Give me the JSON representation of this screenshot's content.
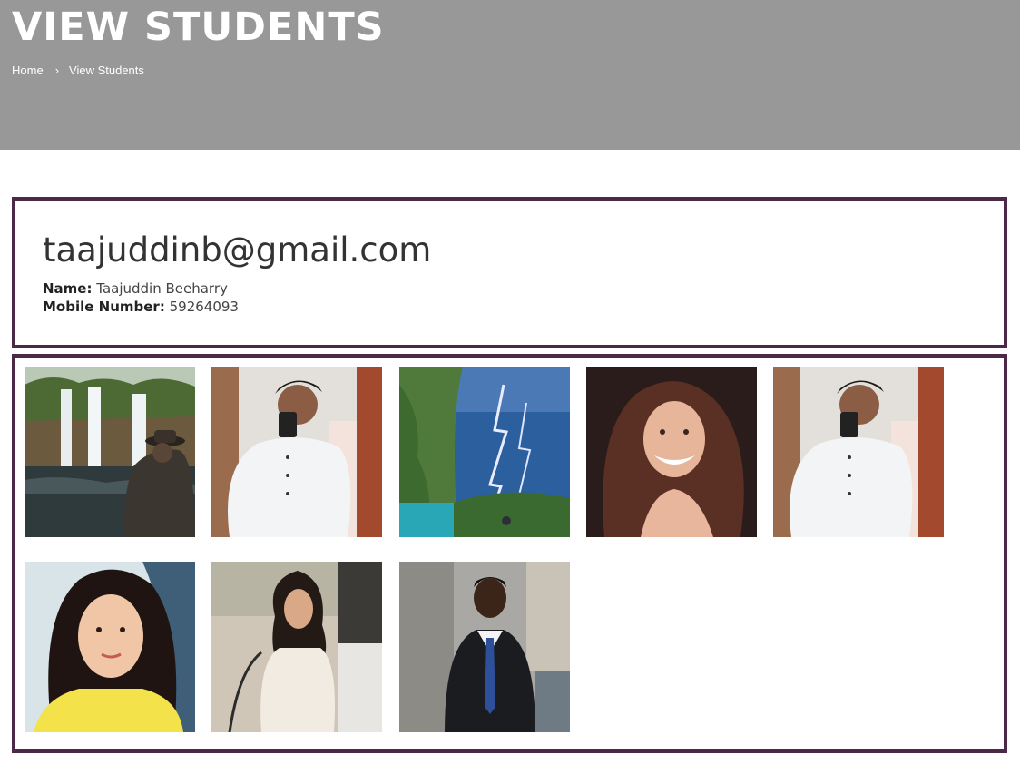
{
  "header": {
    "title": "VIEW STUDENTS",
    "breadcrumb": {
      "home": "Home",
      "separator": "›",
      "current": "View Students"
    }
  },
  "student": {
    "email": "taajuddinb@gmail.com",
    "name_label": "Name:",
    "name": "Taajuddin Beeharry",
    "mobile_label": "Mobile Number:",
    "mobile": "59264093"
  },
  "colors": {
    "hero_bg": "#989898",
    "card_border": "#4a2a47"
  },
  "gallery": {
    "photos": [
      {
        "subject": "waterfall-with-person-in-hat"
      },
      {
        "subject": "man-mirror-selfie-white-shirt"
      },
      {
        "subject": "lightning-storm-landscape"
      },
      {
        "subject": "smiling-woman-curly-hair"
      },
      {
        "subject": "man-mirror-selfie-white-shirt"
      },
      {
        "subject": "woman-portrait-yellow-top"
      },
      {
        "subject": "woman-white-sweater-sitting"
      },
      {
        "subject": "man-in-suit-blue-tie"
      }
    ]
  }
}
